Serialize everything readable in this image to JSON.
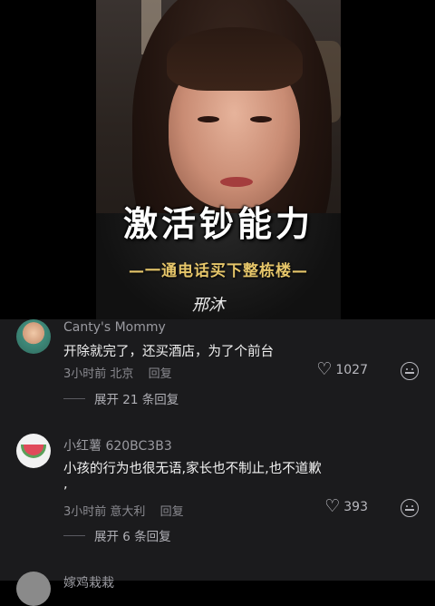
{
  "video": {
    "title": "激活钞能力",
    "subtitle": "—一通电话买下整栋楼—",
    "signature": "邢沐"
  },
  "comments": [
    {
      "user": "Canty's Mommy",
      "text": "开除就完了，还买酒店，为了个前台",
      "time": "3小时前",
      "location": "北京",
      "reply_label": "回复",
      "likes": "1027",
      "expand": "展开 21 条回复",
      "avatar_icon": "girl-avatar"
    },
    {
      "user": "小红薯 620BC3B3",
      "text": "小孩的行为也很无语,家长也不制止,也不道歉",
      "text2": ",",
      "time": "3小时前",
      "location": "意大利",
      "reply_label": "回复",
      "likes": "393",
      "expand": "展开 6 条回复",
      "avatar_icon": "watermelon-avatar"
    },
    {
      "user": "嫁鸡栽栽"
    }
  ]
}
